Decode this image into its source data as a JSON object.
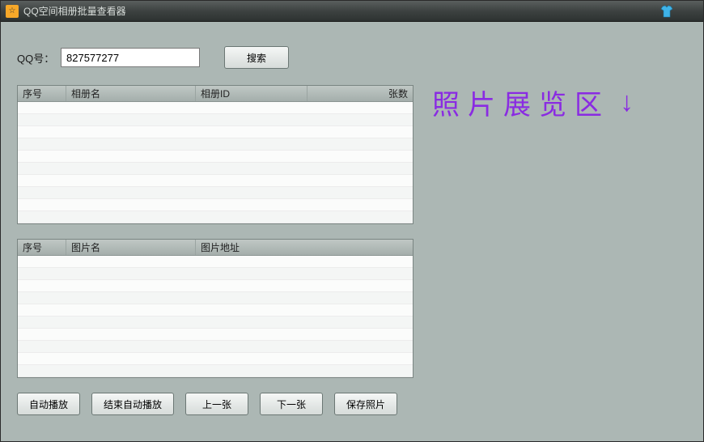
{
  "titlebar": {
    "title": "QQ空间相册批量查看器"
  },
  "search": {
    "label": "QQ号：",
    "value": "827577277",
    "button": "搜索"
  },
  "table1": {
    "headers": {
      "c1": "序号",
      "c2": "相册名",
      "c3": "相册ID",
      "c4": "张数"
    }
  },
  "table2": {
    "headers": {
      "c1": "序号",
      "c2": "图片名",
      "c3": "图片地址"
    }
  },
  "buttons": {
    "auto_play": "自动播放",
    "stop_auto": "结束自动播放",
    "prev": "上一张",
    "next": "下一张",
    "save": "保存照片"
  },
  "preview": {
    "label": "照片展览区",
    "arrow": "↓"
  }
}
